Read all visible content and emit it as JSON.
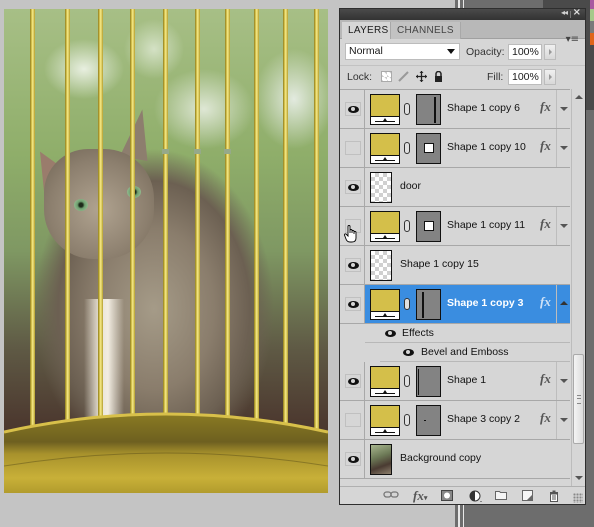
{
  "panel": {
    "tabs": [
      {
        "label": "LAYERS",
        "active": true
      },
      {
        "label": "CHANNELS",
        "active": false
      }
    ],
    "blend_mode": "Normal",
    "opacity_label": "Opacity:",
    "opacity_value": "100%",
    "lock_label": "Lock:",
    "lock_icons": [
      "lock-transparent-pixels-icon",
      "lock-image-pixels-icon",
      "lock-position-icon",
      "lock-all-icon"
    ],
    "fill_label": "Fill:",
    "fill_value": "100%",
    "titlebar_icons": [
      "collapse-icon",
      "close-icon"
    ],
    "menu_icon": "panel-menu-icon"
  },
  "layers": [
    {
      "name": "Shape 1 copy 6",
      "visible": true,
      "thumb": "fill",
      "mask": "vertical-line-right",
      "fx": true,
      "selected": false
    },
    {
      "name": "Shape 1 copy 10",
      "visible": false,
      "thumb": "fill",
      "mask": "small-square",
      "fx": true,
      "selected": false
    },
    {
      "name": "door",
      "visible": true,
      "thumb": "transparent",
      "mask": null,
      "fx": false,
      "selected": false
    },
    {
      "name": "Shape 1 copy 11",
      "visible": false,
      "thumb": "fill",
      "mask": "small-square",
      "fx": true,
      "selected": false
    },
    {
      "name": "Shape 1 copy 15",
      "visible": true,
      "thumb": "transparent",
      "mask": null,
      "fx": false,
      "selected": false
    },
    {
      "name": "Shape 1 copy 3",
      "visible": true,
      "thumb": "fill",
      "mask": "vertical-line-left",
      "fx": true,
      "selected": true
    },
    {
      "name": "Shape 1",
      "visible": true,
      "thumb": "fill",
      "mask": "edge-line",
      "fx": true,
      "selected": false
    },
    {
      "name": "Shape 3 copy 2",
      "visible": false,
      "thumb": "fill",
      "mask": "dot",
      "fx": true,
      "selected": false
    },
    {
      "name": "Background copy",
      "visible": true,
      "thumb": "photo",
      "mask": null,
      "fx": false,
      "selected": false
    }
  ],
  "effects": {
    "label": "Effects",
    "items": [
      "Bevel and Emboss"
    ]
  },
  "bottom_bar": [
    "link-layers-icon",
    "add-layer-style-icon",
    "add-mask-icon",
    "adjustment-layer-icon",
    "new-group-icon",
    "new-layer-icon",
    "delete-layer-icon"
  ],
  "colors": {
    "selection": "#3a8de0",
    "panel_bg": "#d6d6d6",
    "shape_fill": "#d4bf4a",
    "cage_gold": "#c9b33a"
  }
}
